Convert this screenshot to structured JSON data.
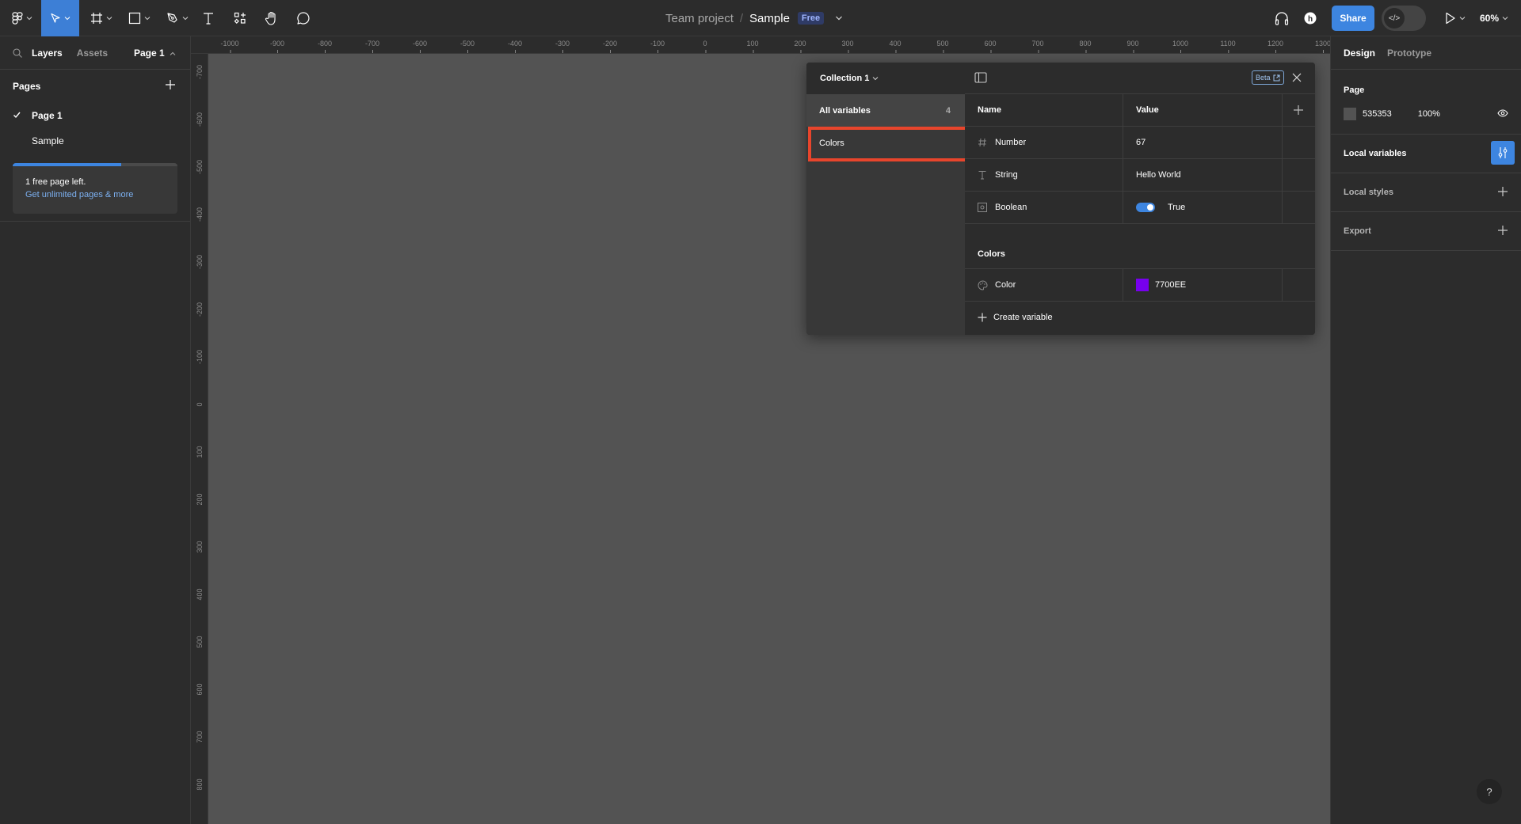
{
  "toolbar": {
    "tools": [
      {
        "name": "main-menu",
        "icon": "figma-logo-icon"
      },
      {
        "name": "move",
        "icon": "pointer-icon",
        "active": true
      },
      {
        "name": "frame",
        "icon": "frame-icon"
      },
      {
        "name": "shape",
        "icon": "rectangle-icon"
      },
      {
        "name": "pen",
        "icon": "pen-icon"
      },
      {
        "name": "text",
        "icon": "text-icon"
      },
      {
        "name": "resources",
        "icon": "resources-icon"
      },
      {
        "name": "hand",
        "icon": "hand-icon"
      },
      {
        "name": "comment",
        "icon": "comment-icon"
      }
    ],
    "project": "Team project",
    "separator": "/",
    "file_name": "Sample",
    "plan_badge": "Free",
    "share_label": "Share",
    "dev_mode_icon": "</>",
    "zoom": "60%"
  },
  "left_panel": {
    "tabs": [
      "Layers",
      "Assets"
    ],
    "page_selector": "Page 1",
    "pages_title": "Pages",
    "pages": [
      {
        "label": "Page 1",
        "active": true
      },
      {
        "label": "Sample",
        "active": false
      }
    ],
    "upsell": {
      "progress": 0.66,
      "text": "1 free page left.",
      "link": "Get unlimited pages & more"
    }
  },
  "rulers": {
    "horizontal": [
      "-1000",
      "-900",
      "-800",
      "-700",
      "-600",
      "-500",
      "-400",
      "-300",
      "-200",
      "-100",
      "0",
      "100",
      "200",
      "300",
      "400",
      "500",
      "600",
      "700",
      "800",
      "900",
      "1000",
      "1100",
      "1200",
      "1300"
    ],
    "vertical": [
      "-700",
      "-600",
      "-500",
      "-400",
      "-300",
      "-200",
      "-100",
      "0",
      "100",
      "200",
      "300",
      "400",
      "500",
      "600",
      "700",
      "800"
    ]
  },
  "variables_modal": {
    "collection": "Collection 1",
    "all_variables_label": "All variables",
    "all_variables_count": "4",
    "groups": [
      "Colors"
    ],
    "beta_label": "Beta",
    "columns": {
      "name": "Name",
      "value": "Value"
    },
    "variables": [
      {
        "type_icon": "number-icon",
        "name": "Number",
        "value": "67"
      },
      {
        "type_icon": "string-icon",
        "name": "String",
        "value": "Hello World"
      },
      {
        "type_icon": "boolean-icon",
        "name": "Boolean",
        "value": "True",
        "toggle_on": true
      }
    ],
    "color_group_label": "Colors",
    "color_variables": [
      {
        "type_icon": "color-icon",
        "name": "Color",
        "value": "7700EE",
        "swatch": "#7700EE"
      }
    ],
    "create_label": "Create variable"
  },
  "right_panel": {
    "tabs": [
      "Design",
      "Prototype"
    ],
    "page_section": {
      "title": "Page",
      "color": "535353",
      "opacity": "100%"
    },
    "local_variables": "Local variables",
    "local_styles": "Local styles",
    "export": "Export"
  },
  "help_label": "?"
}
